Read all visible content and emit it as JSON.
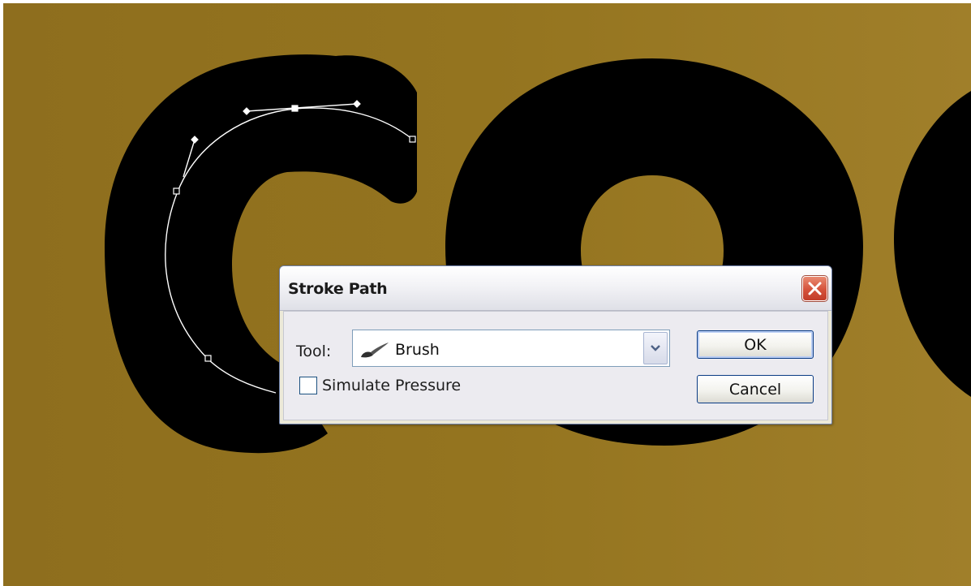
{
  "dialog": {
    "title": "Stroke Path",
    "tool_label": "Tool:",
    "tool_value": "Brush",
    "simulate_pressure_label": "Simulate Pressure",
    "simulate_pressure_checked": false,
    "ok_label": "OK",
    "cancel_label": "Cancel"
  },
  "icons": {
    "close": "close-icon",
    "brush": "brush-icon",
    "dropdown": "chevron-down-icon"
  },
  "colors": {
    "canvas_background": "#94741f",
    "letter_fill": "#000000",
    "path_stroke": "#ffffff",
    "close_button": "#d5523b"
  },
  "canvas": {
    "artwork_text": "Coo"
  }
}
